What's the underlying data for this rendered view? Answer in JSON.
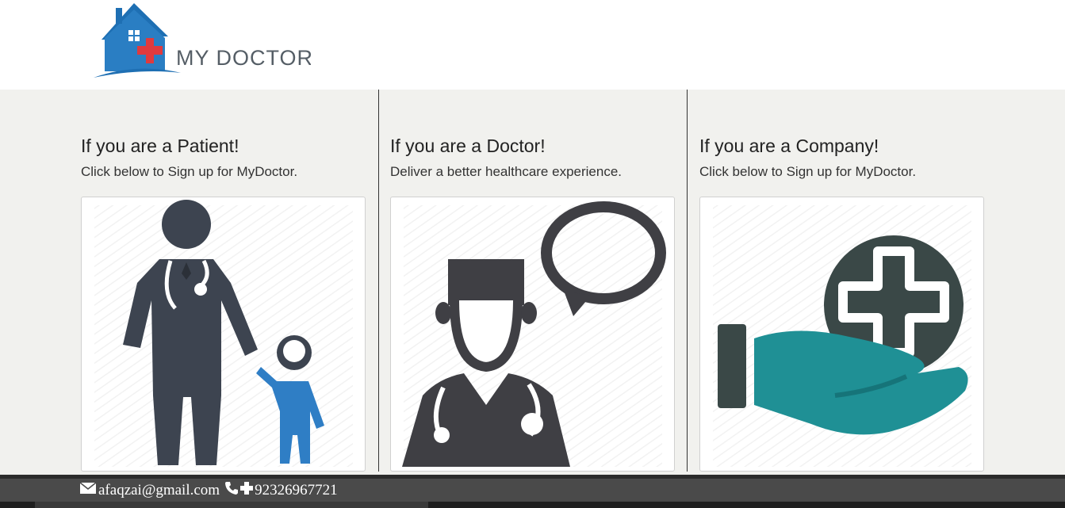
{
  "header": {
    "logo_text": "MY DOCTOR",
    "colors": {
      "house": "#1e6fb3",
      "cross": "#e03a3e"
    }
  },
  "columns": [
    {
      "title": "If you are a Patient!",
      "subtitle": "Click below to Sign up for MyDoctor.",
      "image_icon": "doctor-with-child-icon"
    },
    {
      "title": "If you are a Doctor!",
      "subtitle": "Deliver a better healthcare experience.",
      "image_icon": "doctor-speech-bubble-icon"
    },
    {
      "title": "If you are a Company!",
      "subtitle": "Click below to Sign up for MyDoctor.",
      "image_icon": "hand-medical-cross-icon"
    }
  ],
  "footer": {
    "email": "afaqzai@gmail.com",
    "phone": "92326967721"
  }
}
